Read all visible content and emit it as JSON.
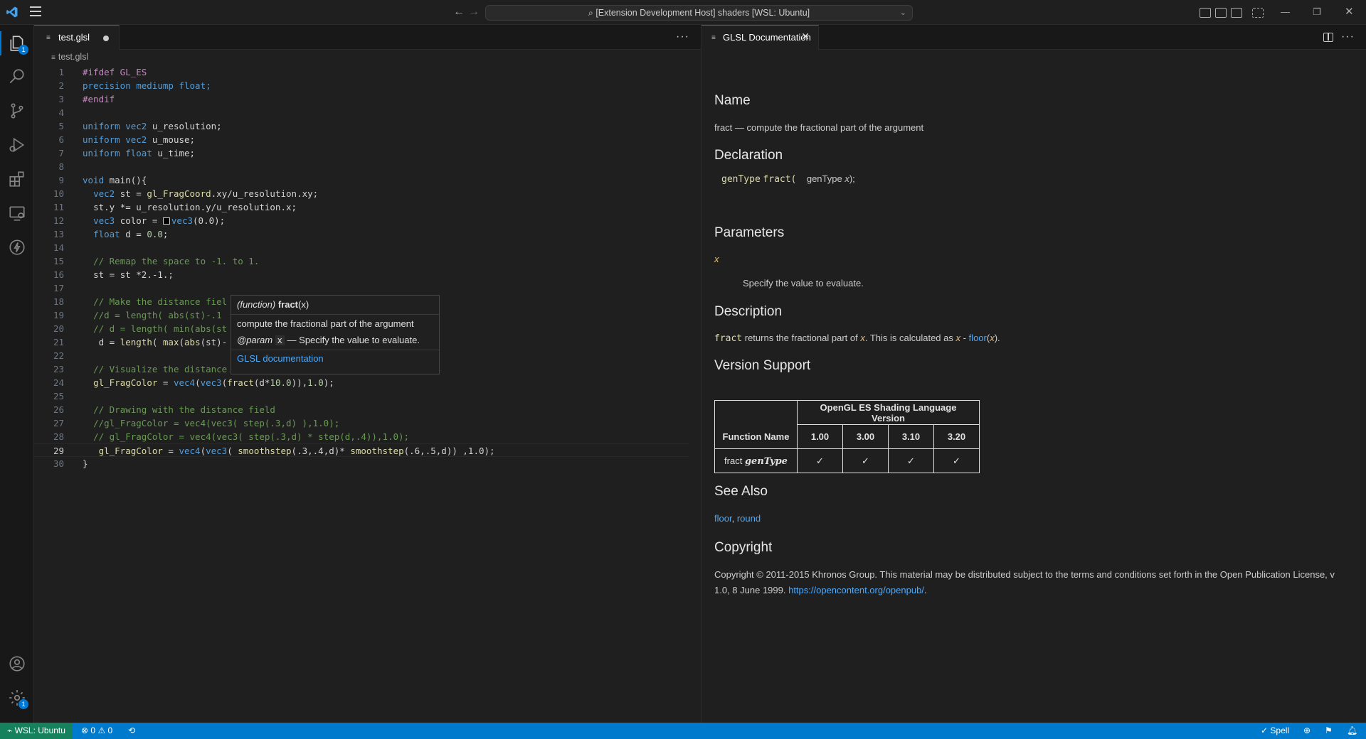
{
  "titlebar": {
    "command_center": "[Extension Development Host] shaders [WSL: Ubuntu]"
  },
  "activity_bar": {
    "explorer_badge": "1",
    "settings_badge": "1"
  },
  "left_editor": {
    "tab_label": "test.glsl",
    "breadcrumb": "test.glsl",
    "lines": [
      {
        "n": "1"
      },
      {
        "n": "2"
      },
      {
        "n": "3"
      },
      {
        "n": "4"
      },
      {
        "n": "5"
      },
      {
        "n": "6"
      },
      {
        "n": "7"
      },
      {
        "n": "8"
      },
      {
        "n": "9"
      },
      {
        "n": "10"
      },
      {
        "n": "11"
      },
      {
        "n": "12"
      },
      {
        "n": "13"
      },
      {
        "n": "14"
      },
      {
        "n": "15"
      },
      {
        "n": "16"
      },
      {
        "n": "17"
      },
      {
        "n": "18"
      },
      {
        "n": "19"
      },
      {
        "n": "20"
      },
      {
        "n": "21"
      },
      {
        "n": "22"
      },
      {
        "n": "23"
      },
      {
        "n": "24"
      },
      {
        "n": "25"
      },
      {
        "n": "26"
      },
      {
        "n": "27"
      },
      {
        "n": "28"
      },
      {
        "n": "29"
      },
      {
        "n": "30"
      }
    ],
    "code": {
      "l1": "#ifdef GL_ES",
      "l2a": "precision mediump float;",
      "l3": "#endif",
      "l5a": "uniform",
      "l5b": "vec2",
      "l5c": " u_resolution;",
      "l6a": "uniform",
      "l6b": "vec2",
      "l6c": " u_mouse;",
      "l7a": "uniform",
      "l7b": "float",
      "l7c": " u_time;",
      "l9a": "void",
      "l9b": " main(){",
      "l10a": "vec2",
      "l10b": " st = ",
      "l10c": "gl_FragCoord",
      "l10d": ".xy/u_resolution.xy;",
      "l11": "st.y *= u_resolution.y/u_resolution.x;",
      "l12a": "vec3",
      "l12b": " color = ",
      "l12c": "vec3",
      "l12d": "(0.0);",
      "l13a": "float",
      "l13b": " d = ",
      "l13c": "0.0",
      "l13d": ";",
      "l15": "// Remap the space to -1. to 1.",
      "l16": "st = st *2.-1.;",
      "l18": "// Make the distance fiel",
      "l19": "//d = length( abs(st)-.1",
      "l20": "// d = length( min(abs(st",
      "l21a": "d = ",
      "l21b": "length",
      "l21c": "( ",
      "l21d": "max",
      "l21e": "(",
      "l21f": "abs",
      "l21g": "(st)-",
      "l23": "// Visualize the distance",
      "l24a": "gl_FragColor",
      "l24b": " = ",
      "l24c": "vec4",
      "l24d": "(",
      "l24e": "vec3",
      "l24f": "(",
      "l24g": "fract",
      "l24h": "(d*",
      "l24i": "10.0",
      "l24j": ")),",
      "l24k": "1.0",
      "l24l": ");",
      "l26": "// Drawing with the distance field",
      "l27": "//gl_FragColor = vec4(vec3( step(.3,d) ),1.0);",
      "l28": "// gl_FragColor = vec4(vec3( step(.3,d) * step(d,.4)),1.0);",
      "l29a": "gl_FragColor",
      "l29b": " = ",
      "l29c": "vec4",
      "l29d": "(",
      "l29e": "vec3",
      "l29f": "( ",
      "l29g": "smoothstep",
      "l29h": "(.3,.4,d)* ",
      "l29i": "smoothstep",
      "l29j": "(.6,.5,d)) ,1.0);",
      "l30": "}"
    }
  },
  "hover": {
    "kind": "(function)",
    "name": "fract",
    "args": "(x)",
    "description": "compute the fractional part of the argument",
    "param_tag": "@param",
    "param_name": "x",
    "param_desc": "— Specify the value to evaluate.",
    "link": "GLSL documentation"
  },
  "right_editor": {
    "tab_label": "GLSL Documentation",
    "sections": {
      "name_h": "Name",
      "name_text": "fract — compute the fractional part of the argument",
      "decl_h": "Declaration",
      "decl_type": "genType",
      "decl_fn": "fract(",
      "decl_param_type": "genType",
      "decl_param": "x",
      "decl_end": ");",
      "params_h": "Parameters",
      "param_name": "x",
      "param_desc": "Specify the value to evaluate.",
      "desc_h": "Description",
      "desc_fn": "fract",
      "desc_text1": " returns the fractional part of ",
      "desc_x": "x",
      "desc_text2": ". This is calculated as ",
      "desc_x2": "x",
      "desc_text3": " - ",
      "desc_floor": "floor",
      "desc_text4": "(",
      "desc_x3": "x",
      "desc_text5": ").",
      "version_h": "Version Support",
      "table": {
        "header": "OpenGL ES Shading Language Version",
        "func_col": "Function Name",
        "versions": [
          "1.00",
          "3.00",
          "3.10",
          "3.20"
        ],
        "row_name": "fract",
        "row_type": "genType",
        "check": "✓"
      },
      "see_h": "See Also",
      "see_floor": "floor",
      "see_sep": ", ",
      "see_round": "round",
      "copy_h": "Copyright",
      "copy_text": "Copyright © 2011-2015 Khronos Group. This material may be distributed subject to the terms and conditions set forth in the Open Publication License, v 1.0, 8 June 1999. ",
      "copy_link": "https://opencontent.org/openpub/",
      "copy_end": "."
    }
  },
  "statusbar": {
    "remote": "WSL: Ubuntu",
    "errors": "0",
    "warnings": "0",
    "spell": "Spell"
  }
}
